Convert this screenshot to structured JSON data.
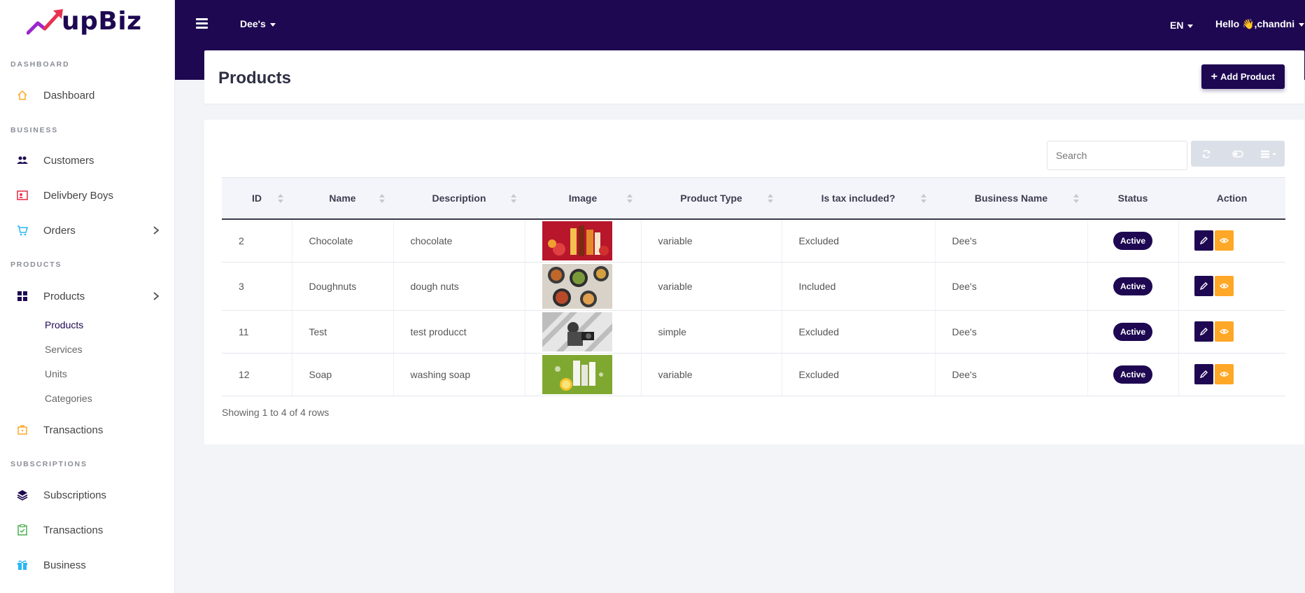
{
  "brand": {
    "name": "upBiz"
  },
  "topbar": {
    "business": "Dee's",
    "language": "EN",
    "greeting": "Hello 👋,chandni"
  },
  "sidebar": {
    "sections": {
      "dashboard": "DASHBOARD",
      "business": "BUSINESS",
      "products": "PRODUCTS",
      "subscriptions": "SUBSCRIPTIONS"
    },
    "items": {
      "dashboard": "Dashboard",
      "customers": "Customers",
      "delivery_boys": "Delivbery Boys",
      "orders": "Orders",
      "products": "Products",
      "transactions": "Transactions",
      "subscriptions": "Subscriptions",
      "sub_transactions": "Transactions",
      "business": "Business"
    },
    "product_sub": {
      "products": "Products",
      "services": "Services",
      "units": "Units",
      "categories": "Categories"
    }
  },
  "page": {
    "title": "Products",
    "add_button": "Add Product"
  },
  "search": {
    "placeholder": "Search"
  },
  "table": {
    "headers": {
      "id": "ID",
      "name": "Name",
      "description": "Description",
      "image": "Image",
      "product_type": "Product Type",
      "tax": "Is tax included?",
      "business": "Business Name",
      "status": "Status",
      "action": "Action"
    },
    "rows": [
      {
        "id": "2",
        "name": "Chocolate",
        "description": "chocolate",
        "product_type": "variable",
        "tax": "Excluded",
        "business": "Dee's",
        "status": "Active"
      },
      {
        "id": "3",
        "name": "Doughnuts",
        "description": "dough nuts",
        "product_type": "variable",
        "tax": "Included",
        "business": "Dee's",
        "status": "Active"
      },
      {
        "id": "11",
        "name": "Test",
        "description": "test producct",
        "product_type": "simple",
        "tax": "Excluded",
        "business": "Dee's",
        "status": "Active"
      },
      {
        "id": "12",
        "name": "Soap",
        "description": "washing soap",
        "product_type": "variable",
        "tax": "Excluded",
        "business": "Dee's",
        "status": "Active"
      }
    ],
    "footer": "Showing 1 to 4 of 4 rows"
  },
  "colors": {
    "primary": "#1e0852",
    "accent": "#ffa726",
    "background": "#f3f4f8"
  }
}
